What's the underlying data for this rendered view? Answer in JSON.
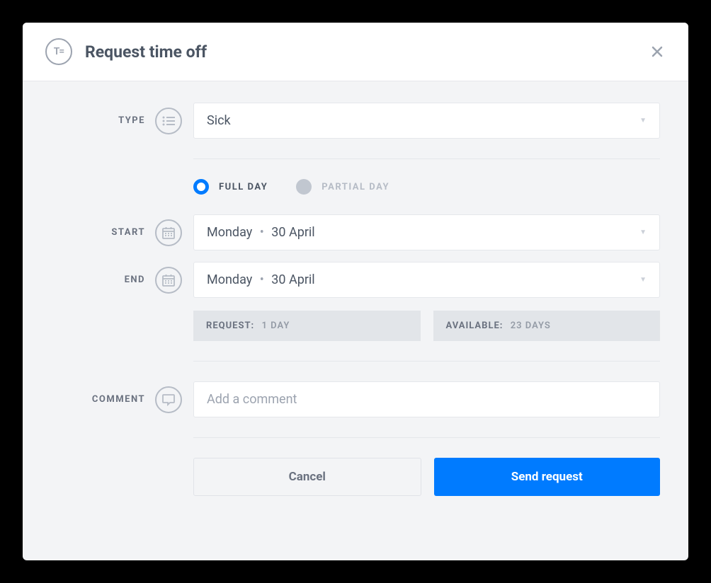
{
  "header": {
    "logo_text": "T=",
    "title": "Request time off"
  },
  "form": {
    "type": {
      "label": "TYPE",
      "value": "Sick"
    },
    "duration": {
      "full_day": "FULL DAY",
      "partial_day": "PARTIAL DAY"
    },
    "start": {
      "label": "START",
      "weekday": "Monday",
      "date": "30 April"
    },
    "end": {
      "label": "END",
      "weekday": "Monday",
      "date": "30 April"
    },
    "summary": {
      "request_label": "REQUEST:",
      "request_value": "1 DAY",
      "available_label": "AVAILABLE:",
      "available_value": "23 DAYS"
    },
    "comment": {
      "label": "COMMENT",
      "placeholder": "Add a comment"
    }
  },
  "actions": {
    "cancel": "Cancel",
    "send": "Send request"
  }
}
